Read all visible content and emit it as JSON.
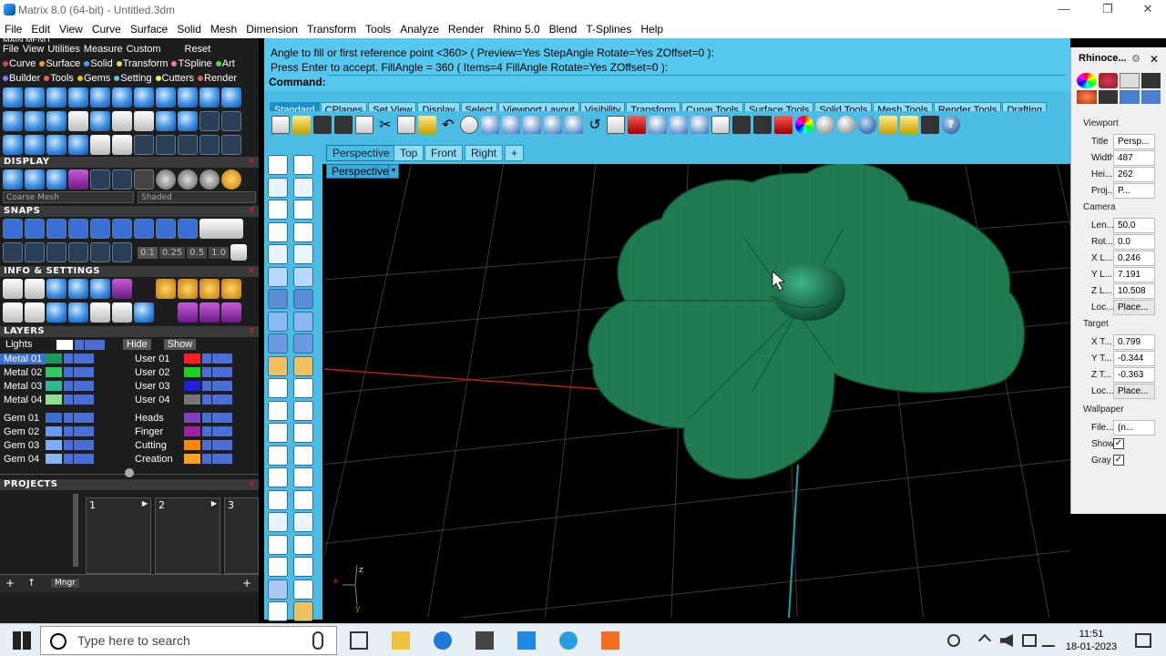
{
  "window": {
    "title": "Matrix 8.0 (64-bit) - Untitled.3dm",
    "minimize": "—",
    "restore": "❐",
    "close": "✕"
  },
  "menubar": [
    "File",
    "Edit",
    "View",
    "Curve",
    "Surface",
    "Solid",
    "Mesh",
    "Dimension",
    "Transform",
    "Tools",
    "Analyze",
    "Render",
    "Rhino 5.0",
    "Blend",
    "T-Splines",
    "Help"
  ],
  "leftpanel": {
    "header_cut": "MAIN MENU",
    "row1": [
      "File",
      "View",
      "Utilities",
      "Measure",
      "Custom",
      "Reset"
    ],
    "row2": [
      {
        "label": "Curve",
        "color": "#e04040"
      },
      {
        "label": "Surface",
        "color": "#f0a020"
      },
      {
        "label": "Solid",
        "color": "#40a0f0"
      },
      {
        "label": "Transform",
        "color": "#e0e040"
      },
      {
        "label": "TSpline",
        "color": "#f08080"
      },
      {
        "label": "Art",
        "color": "#40e040"
      }
    ],
    "row3": [
      {
        "label": "Builder",
        "color": "#8080ff"
      },
      {
        "label": "Tools",
        "color": "#f06040"
      },
      {
        "label": "Gems",
        "color": "#f0c020"
      },
      {
        "label": "Setting",
        "color": "#60c0f0"
      },
      {
        "label": "Cutters",
        "color": "#f0f060"
      },
      {
        "label": "Render",
        "color": "#e06060"
      }
    ],
    "sections": {
      "display": "DISPLAY",
      "snaps": "SNAPS",
      "info": "INFO & SETTINGS",
      "layers": "LAYERS",
      "projects": "PROJECTS"
    },
    "display_mesh": "Coarse Mesh",
    "display_mode": "Shaded",
    "snap_values": [
      "0.1",
      "0.25",
      "0.5",
      "1.0"
    ],
    "layers_lights": "Lights",
    "layers_hide": "Hide",
    "layers_show": "Show",
    "layers_left": [
      {
        "name": "Metal 01",
        "color": "#1a9a5a",
        "selected": true
      },
      {
        "name": "Metal 02",
        "color": "#30c860"
      },
      {
        "name": "Metal 03",
        "color": "#2fb890"
      },
      {
        "name": "Metal 04",
        "color": "#8de08d"
      },
      {
        "name": "Gem 01",
        "color": "#3a6fd8"
      },
      {
        "name": "Gem 02",
        "color": "#6a9af0"
      },
      {
        "name": "Gem 03",
        "color": "#7ab0f8"
      },
      {
        "name": "Gem 04",
        "color": "#8ab4f8"
      }
    ],
    "layers_right": [
      {
        "name": "User 01",
        "color": "#ff2020"
      },
      {
        "name": "User 02",
        "color": "#20d020"
      },
      {
        "name": "User 03",
        "color": "#2020e0"
      },
      {
        "name": "User 04",
        "color": "#777777"
      },
      {
        "name": "Heads",
        "color": "#8040c0"
      },
      {
        "name": "Finger",
        "color": "#a020a0"
      },
      {
        "name": "Cutting",
        "color": "#ff8800"
      },
      {
        "name": "Creation",
        "color": "#ffa020"
      }
    ],
    "project_slots": [
      "1",
      "2",
      "3"
    ],
    "bottom_mngr": "Mngr"
  },
  "command": {
    "line1": "Angle to fill or first reference point <360> ( Preview=Yes  StepAngle  Rotate=Yes  ZOffset=0 ):",
    "line2": "Press Enter to accept. FillAngle = 360 ( Items=4  FillAngle  Rotate=Yes  ZOffset=0 ):",
    "prompt": "Command:"
  },
  "toolbar_tabs": [
    "Standard",
    "CPlanes",
    "Set View",
    "Display",
    "Select",
    "Viewport Layout",
    "Visibility",
    "Transform",
    "Curve Tools",
    "Surface Tools",
    "Solid Tools",
    "Mesh Tools",
    "Render Tools",
    "Drafting"
  ],
  "viewport_tabs": [
    "Perspective",
    "Top",
    "Front",
    "Right",
    "+"
  ],
  "viewport_label": "Perspective",
  "axis": {
    "x": "x",
    "y": "y",
    "z": "z"
  },
  "properties": {
    "title": "Rhinoce...",
    "viewport_section": "Viewport",
    "rows_viewport": [
      {
        "k": "Title",
        "v": "Persp..."
      },
      {
        "k": "Width",
        "v": "487"
      },
      {
        "k": "Hei...",
        "v": "262"
      },
      {
        "k": "Proj...",
        "v": "P..."
      }
    ],
    "camera_section": "Camera",
    "rows_camera": [
      {
        "k": "Len...",
        "v": "50.0"
      },
      {
        "k": "Rot...",
        "v": "0.0"
      },
      {
        "k": "X L...",
        "v": "0.246"
      },
      {
        "k": "Y L...",
        "v": "7.191"
      },
      {
        "k": "Z L...",
        "v": "10.508"
      },
      {
        "k": "Loc...",
        "v": "Place..."
      }
    ],
    "target_section": "Target",
    "rows_target": [
      {
        "k": "X T...",
        "v": "0.799"
      },
      {
        "k": "Y T...",
        "v": "-0.344"
      },
      {
        "k": "Z T...",
        "v": "-0.363"
      },
      {
        "k": "Loc...",
        "v": "Place..."
      }
    ],
    "wallpaper_section": "Wallpaper",
    "rows_wallpaper": [
      {
        "k": "File...",
        "v": "(n..."
      },
      {
        "k": "Show",
        "v": "✓"
      },
      {
        "k": "Gray",
        "v": "✓"
      }
    ]
  },
  "taskbar": {
    "search_placeholder": "Type here to search",
    "time": "11:51",
    "date": "18-01-2023"
  },
  "colors": {
    "accent": "#4bbde5",
    "model_green": "#1f7a4f",
    "grid": "#3a3a3a"
  }
}
